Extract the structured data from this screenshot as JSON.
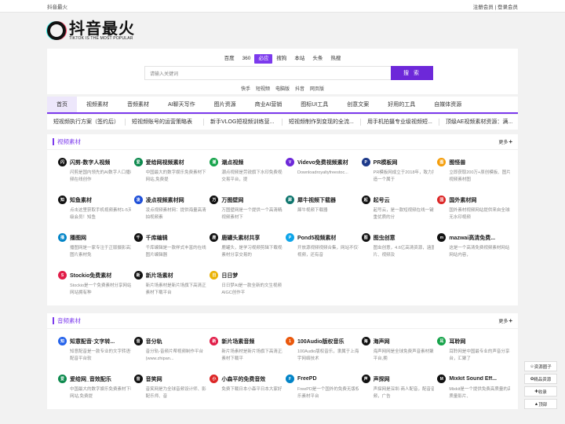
{
  "top": {
    "site": "抖音最火",
    "links": "注册会员 | 登录会员"
  },
  "logo": {
    "title": "抖音最火",
    "subtitle": "TIKTOK IS THE MOST POPULAR"
  },
  "search": {
    "engines": [
      "百度",
      "360",
      "必应",
      "搜狗",
      "本站",
      "头条",
      "热搜"
    ],
    "active_engine": "必应",
    "placeholder": "请输入关键词",
    "button": "搜 索",
    "hot": [
      "快手",
      "短视频",
      "电脑版",
      "抖音",
      "网页版"
    ]
  },
  "nav": [
    "首页",
    "视频素材",
    "音频素材",
    "AI聊天写作",
    "图片资源",
    "商业AI营销",
    "图标UI工具",
    "创意文案",
    "好用的工具",
    "自媒体资源"
  ],
  "ticker": [
    "短视频执行方案（签约后）",
    "短视频账号的运营策略表",
    "新手VLOG短视频训练营...",
    "短视频制作到变现的全流...",
    "用手机拍摄专业级视频短...",
    "顶级AE视频素材资源：满..."
  ],
  "sections": [
    {
      "title": "视频素材",
      "more": "更多",
      "items": [
        {
          "name": "闪剪-数字人视频",
          "desc": "闪剪是国内领先的AI数字人口播视频在线创作",
          "icon": "闪",
          "color": "#111111"
        },
        {
          "name": "爱给网视频素材",
          "desc": "中国最大的数字娱乐免费素材下载网站,免费提",
          "icon": "爱",
          "color": "#0d8a4e"
        },
        {
          "name": "潮点视频",
          "desc": "潮点视频是劳锐旗下水印免费视频交易平台，提",
          "icon": "潮",
          "color": "#15a34a"
        },
        {
          "name": "Videvo免费视频素材",
          "desc": "Downloadroyaltyfreestoc...",
          "icon": "V",
          "color": "#6d28d9"
        },
        {
          "name": "PR模板网",
          "desc": "PR模板网成立于2018年，致力打造一个属于",
          "icon": "P",
          "color": "#1e3a8a"
        },
        {
          "name": "图怪兽",
          "desc": "立即获取200万+原创模板、图片、视频素材图",
          "icon": "图",
          "color": "#f59e0b"
        },
        {
          "name": "知鱼素材",
          "desc": "点击这里获取手机视频素材1-5天超级会员！知鱼",
          "icon": "知",
          "color": "#111111"
        },
        {
          "name": "凌点视频素材网",
          "desc": "凌点视频素材网：提供海量高清实拍视频素",
          "icon": "凌",
          "color": "#1d4ed8"
        },
        {
          "name": "万图壁网",
          "desc": "万图壁网是一个提供一个高清精品视频素材下",
          "icon": "万",
          "color": "#111111"
        },
        {
          "name": "犀牛视频下载器",
          "desc": "犀牛视频下载器",
          "icon": "犀",
          "color": "#0f766e"
        },
        {
          "name": "起号云",
          "desc": "起号云，是一款短视频在线一键去重优质的分",
          "icon": "起",
          "color": "#111111"
        },
        {
          "name": "国外素材网",
          "desc": "国外素材视频网站提供来自全球的无水印视频",
          "icon": "国",
          "color": "#dc2626"
        },
        {
          "name": "播图网",
          "desc": "播图网是一家专注于正版摄影高清图片素材免",
          "icon": "播",
          "color": "#0284c7"
        },
        {
          "name": "千库编辑",
          "desc": "千库编辑是一款样式丰富的在线ps图片编辑器",
          "icon": "千",
          "color": "#111111"
        },
        {
          "name": "鹿罐头素材共享",
          "desc": "鹿罐头，是学习视频剪辑下载视频素材分享交易的",
          "icon": "鹿",
          "color": "#111111"
        },
        {
          "name": "Pond5视频素材",
          "desc": "开放源视频视频合集，网站不仅有视频，还有音",
          "icon": "P",
          "color": "#0ea5e9"
        },
        {
          "name": "图虫创意",
          "desc": "图虫创意，4.6亿高清资源，涵盖图片、视频及",
          "icon": "图",
          "color": "#111111"
        },
        {
          "name": "mazwai高清免费...",
          "desc": "这是一个高清免费视频素材网站，网站内容，",
          "icon": "m",
          "color": "#111111"
        },
        {
          "name": "Stockio免费素材",
          "desc": "Stockio是一个免费素材分享网站，网站拥有种",
          "icon": "S",
          "color": "#e11d48"
        },
        {
          "name": "新片场素材",
          "desc": "新片场素材是新片场旗下高清正版素材下载平台",
          "icon": "新",
          "color": "#111111"
        },
        {
          "name": "日日梦",
          "desc": "日日梦AI是一款全新的文生视频AIGC创作平",
          "icon": "日",
          "color": "#eab308"
        }
      ]
    },
    {
      "title": "音频素材",
      "more": "更多",
      "items": [
        {
          "name": "知意配音·文字转...",
          "desc": "知意配音是一款专业的文字转语音配音平台软",
          "icon": "知",
          "color": "#2563eb"
        },
        {
          "name": "音分轨",
          "desc": "音分轨-音频片帮视频制作平台(www.zhipan...",
          "icon": "音",
          "color": "#111111"
        },
        {
          "name": "新片场素音频",
          "desc": "新片场素材是新片场旗下高清正版素材下载平",
          "icon": "新",
          "color": "#e11d48"
        },
        {
          "name": "100Audio版权音乐",
          "desc": "100Audio版权音乐，隶属于上海大宇网络技术",
          "icon": "1",
          "color": "#ea580c"
        },
        {
          "name": "海声网",
          "desc": "海声网网是全球免费声音素材聚合平台,拥",
          "icon": "海",
          "color": "#111111"
        },
        {
          "name": "耳聆网",
          "desc": "耳聆网是中国最专业的声音分享平台，汇聚了",
          "icon": "耳",
          "color": "#16a34a"
        },
        {
          "name": "爱给网_音效配乐",
          "desc": "中国最大的数字娱乐免费素材下载网站,免费提",
          "icon": "爱",
          "color": "#0d8a4e"
        },
        {
          "name": "音笑网",
          "desc": "音笑网是为全球音频设计师、影视配乐师、音",
          "icon": "音",
          "color": "#111111"
        },
        {
          "name": "小森平的免费音效",
          "desc": "免费下载日本小森平日本大家好",
          "icon": "小",
          "color": "#dc2626"
        },
        {
          "name": "FreePD",
          "desc": "FreePD是一个国外的免费无版权音乐素材平台",
          "icon": "F",
          "color": "#0284c7"
        },
        {
          "name": "声探网",
          "desc": "声探网是深圳·商人配音，配音音频，广告",
          "icon": "声",
          "color": "#111111"
        },
        {
          "name": "Mixkit Sound Eff...",
          "desc": "Mixkit是一个提供免费高质量的高质量影片、",
          "icon": "M",
          "color": "#111111"
        }
      ]
    }
  ],
  "side": [
    "资源圈子",
    "精品资源",
    "收录",
    "顶部"
  ]
}
